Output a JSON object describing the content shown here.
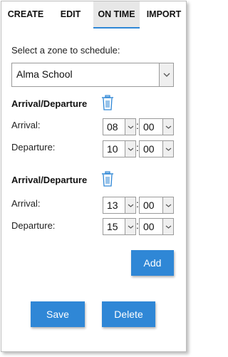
{
  "tabs": [
    {
      "label": "CREATE"
    },
    {
      "label": "EDIT"
    },
    {
      "label": "ON TIME"
    },
    {
      "label": "IMPORT"
    }
  ],
  "active_tab": "ON TIME",
  "zone": {
    "prompt": "Select a zone to schedule:",
    "selected": "Alma School"
  },
  "schedules": [
    {
      "heading": "Arrival/Departure",
      "arrival_label": "Arrival:",
      "arrival_hour": "08",
      "arrival_minute": "00",
      "departure_label": "Departure:",
      "departure_hour": "10",
      "departure_minute": "00"
    },
    {
      "heading": "Arrival/Departure",
      "arrival_label": "Arrival:",
      "arrival_hour": "13",
      "arrival_minute": "00",
      "departure_label": "Departure:",
      "departure_hour": "15",
      "departure_minute": "00"
    }
  ],
  "separator": ":",
  "buttons": {
    "add": "Add",
    "save": "Save",
    "delete": "Delete"
  },
  "colors": {
    "accent": "#2f87d6",
    "trash_icon": "#2f87d6",
    "active_tab_bg": "#e7e7e7"
  },
  "icons": {
    "dropdown": "chevron-down-icon",
    "delete_schedule": "trash-icon"
  }
}
